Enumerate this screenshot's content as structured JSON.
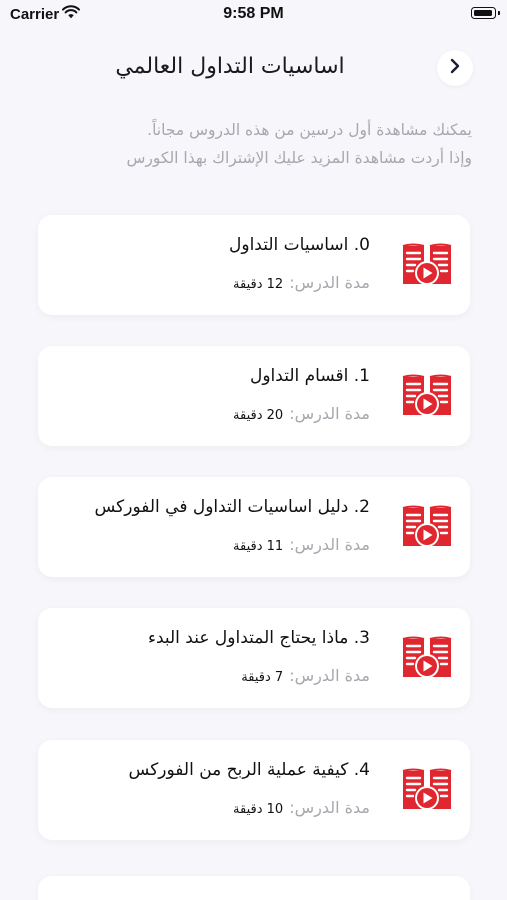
{
  "status_bar": {
    "carrier": "Carrier",
    "time": "9:58 PM"
  },
  "header": {
    "title": "اساسيات التداول العالمي"
  },
  "description": {
    "line1": "يمكنك مشاهدة أول درسين من هذه الدروس مجاناً.",
    "line2": "وإذا أردت مشاهدة المزيد عليك الإشتراك بهذا الكورس"
  },
  "lesson_duration_label": "مدة الدرس:",
  "lessons": [
    {
      "title": "0. اساسيات التداول",
      "duration": "12 دقيقة"
    },
    {
      "title": "1. اقسام التداول",
      "duration": "20 دقيقة"
    },
    {
      "title": "2. دليل اساسيات التداول في الفوركس",
      "duration": "11 دقيقة"
    },
    {
      "title": "3. ماذا يحتاج المتداول عند البدء",
      "duration": "7 دقيقة"
    },
    {
      "title": "4. كيفية عملية الربح من الفوركس",
      "duration": "10 دقيقة"
    }
  ],
  "colors": {
    "accent": "#e0272f",
    "background": "#f7f6fa",
    "muted_text": "#a7a7ae"
  },
  "icons": {
    "back": "chevron-right-icon",
    "lesson": "video-book-icon"
  }
}
